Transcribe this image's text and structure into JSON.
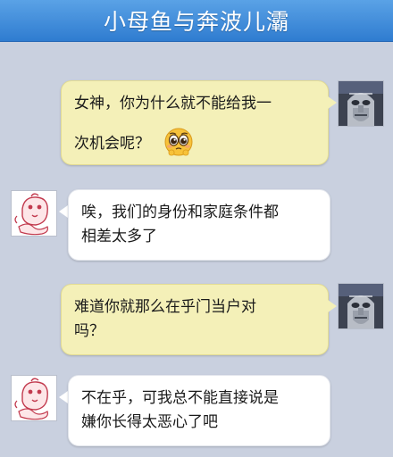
{
  "header": {
    "title": "小母鱼与奔波儿灞"
  },
  "messages": [
    {
      "side": "sent",
      "lines": [
        "女神，你为什么就不能给我一",
        "次机会呢？"
      ],
      "emoji": "pleading-face-icon",
      "avatar": "robot-avatar"
    },
    {
      "side": "recv",
      "lines": [
        "唉，我们的身份和家庭条件都",
        "相差太多了"
      ],
      "avatar": "fish-girl-avatar"
    },
    {
      "side": "sent",
      "lines": [
        "难道你就那么在乎门当户对",
        "吗？"
      ],
      "avatar": "robot-avatar"
    },
    {
      "side": "recv",
      "lines": [
        "不在乎，可我总不能直接说是",
        "嫌你长得太恶心了吧"
      ],
      "avatar": "fish-girl-avatar"
    }
  ],
  "colors": {
    "header": "#3a86d8",
    "background": "#c9d0df",
    "sent_bubble": "#f4f0b8",
    "recv_bubble": "#ffffff"
  }
}
